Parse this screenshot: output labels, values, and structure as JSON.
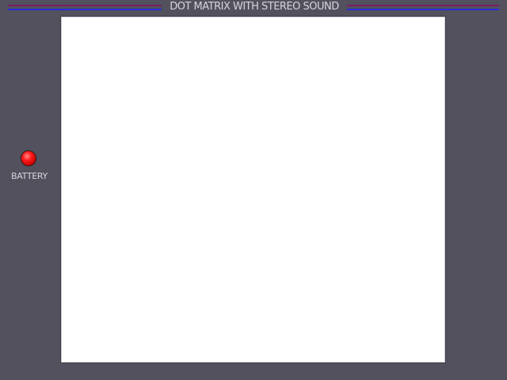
{
  "header": {
    "title": "DOT MATRIX WITH STEREO SOUND"
  },
  "battery": {
    "label": "BATTERY",
    "indicator_icon": "red-led-icon",
    "indicator_color": "#ff1a1a"
  },
  "colors": {
    "background": "#52515d",
    "stripe_top": "#7a1d6a",
    "stripe_bottom": "#2b2bd8",
    "screen": "#ffffff",
    "text": "#d6d5dc"
  }
}
